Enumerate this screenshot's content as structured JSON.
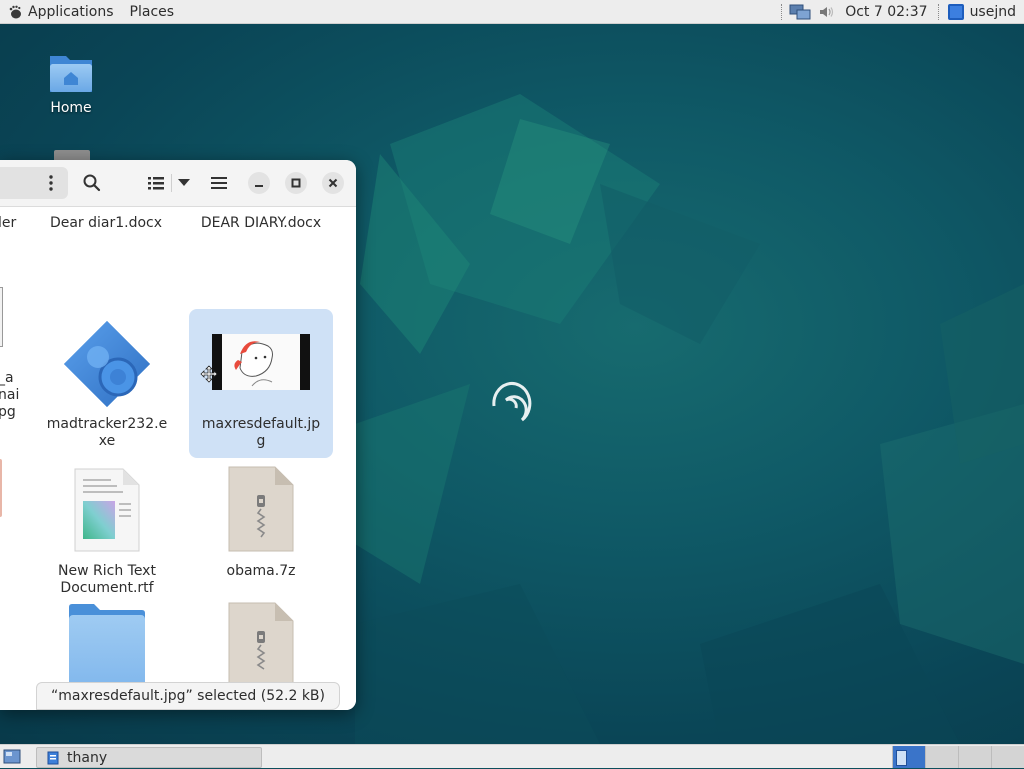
{
  "top_panel": {
    "applications_label": "Applications",
    "places_label": "Places",
    "clock": "Oct 7  02:37",
    "user": "usejnd"
  },
  "desktop": {
    "icons": [
      {
        "label": "Home",
        "icon": "home-folder-icon"
      }
    ]
  },
  "file_manager": {
    "files": [
      {
        "label": "Dear diar1.docx",
        "icon": "document-icon"
      },
      {
        "label": "DEAR DIARY.docx",
        "icon": "document-icon"
      },
      {
        "label": "madtracker232.e\nxe",
        "icon": "executable-icon"
      },
      {
        "label": "maxresdefault.jp\ng",
        "icon": "image-thumbnail",
        "selected": true
      },
      {
        "label": "New Rich Text\nDocument.rtf",
        "icon": "rtf-document-icon"
      },
      {
        "label": "obama.7z",
        "icon": "archive-icon"
      }
    ],
    "partial_left_labels": [
      "ler",
      "_a",
      "nai",
      "pg"
    ],
    "status": "“maxresdefault.jpg” selected  (52.2 kB)"
  },
  "bottom_panel": {
    "task_label": "thany"
  },
  "colors": {
    "selection": "#cfe1f6",
    "desktop_accent": "#0f5966",
    "folder_blue": "#4a90d9"
  }
}
